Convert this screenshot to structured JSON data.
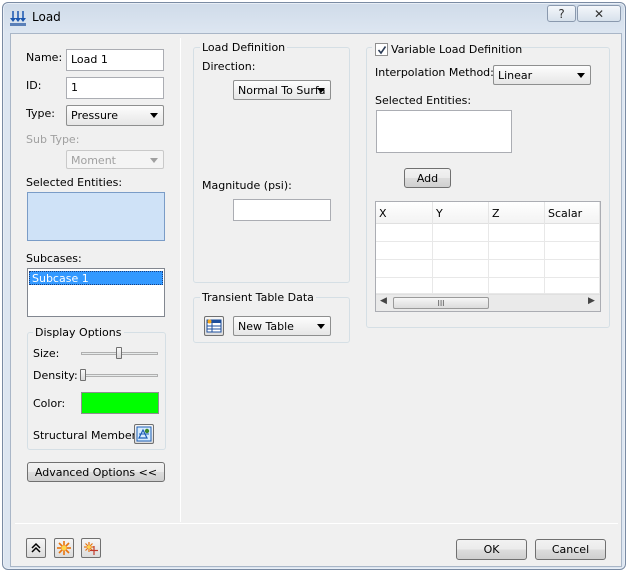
{
  "window": {
    "title": "Load",
    "help_label": "?",
    "close_label": "✕"
  },
  "left": {
    "name_label": "Name:",
    "name_value": "Load 1",
    "id_label": "ID:",
    "id_value": "1",
    "type_label": "Type:",
    "type_value": "Pressure",
    "subtype_label": "Sub Type:",
    "subtype_value": "Moment",
    "selected_entities_label": "Selected Entities:",
    "subcases_label": "Subcases:",
    "subcases": [
      "Subcase 1"
    ],
    "display_options": {
      "title": "Display Options",
      "size_label": "Size:",
      "size_level": 0.5,
      "density_label": "Density:",
      "density_level": 0.0,
      "color_label": "Color:",
      "color": "#00ff00",
      "structural_member_label": "Structural Member"
    },
    "advanced_button": "Advanced Options <<"
  },
  "middle": {
    "load_definition_title": "Load Definition",
    "direction_label": "Direction:",
    "direction_value": "Normal To Surfa",
    "magnitude_label": "Magnitude (psi):",
    "magnitude_value": "",
    "transient_title": "Transient Table Data",
    "transient_value": "New Table"
  },
  "right": {
    "variable_label": "Variable Load Definition",
    "variable_checked": true,
    "interp_label": "Interpolation Method:",
    "interp_value": "Linear",
    "selected_entities_label": "Selected Entities:",
    "add_button": "Add",
    "table_columns": [
      "X",
      "Y",
      "Z",
      "Scalar"
    ],
    "scroll_grip": "III"
  },
  "footer": {
    "ok": "OK",
    "cancel": "Cancel"
  },
  "colors": {
    "selection": "#3399ff",
    "entities_bg": "#cfe2f7",
    "window_frame": "#dde6f1"
  }
}
